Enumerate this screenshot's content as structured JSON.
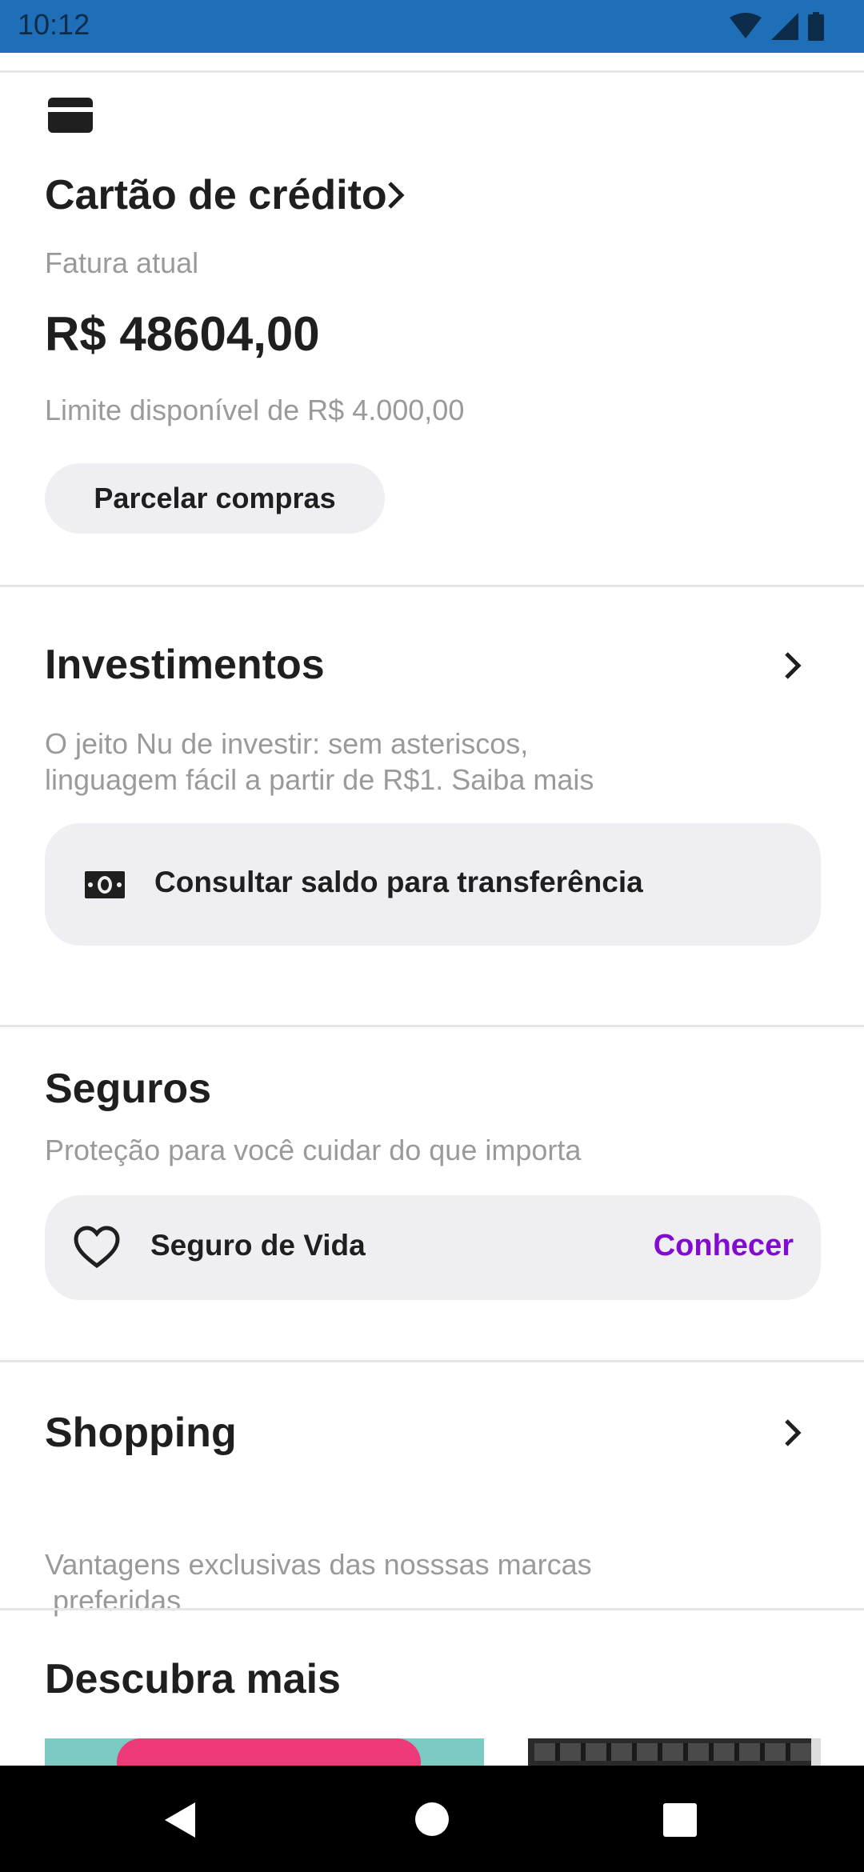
{
  "status_bar": {
    "time": "10:12",
    "icons": [
      "wifi-icon",
      "signal-icon",
      "battery-icon"
    ],
    "background": "#1e6fb8"
  },
  "credit_card": {
    "icon": "credit-card-icon",
    "title": "Cartão de crédito",
    "invoice_label": "Fatura atual",
    "invoice_amount": "R$ 48604,00",
    "limit_text": "Limite disponível de R$ 4.000,00",
    "installments_button": "Parcelar compras"
  },
  "investments": {
    "title": "Investimentos",
    "description_line1": "O jeito Nu de investir: sem asteriscos,",
    "description_line2": "linguagem fácil a partir de R$1. Saiba mais",
    "action_icon": "money-icon",
    "action_label": "Consultar saldo para transferência"
  },
  "insurance": {
    "title": "Seguros",
    "description": "Proteção para você cuidar do que importa",
    "item_icon": "heart-icon",
    "item_label": "Seguro de Vida",
    "item_action": "Conhecer",
    "accent_color": "#820ad1"
  },
  "shopping": {
    "title": "Shopping",
    "description_line1": "Vantagens exclusivas das nosssas marcas",
    "description_line2": " preferidas"
  },
  "discover": {
    "title": "Descubra mais"
  },
  "nav_bar": {
    "buttons": [
      "back-icon",
      "home-icon",
      "recents-icon"
    ]
  }
}
